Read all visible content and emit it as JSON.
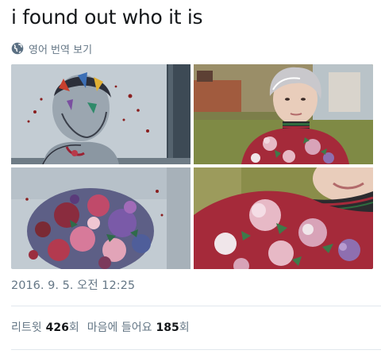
{
  "tweet": {
    "text": "i found out who it is",
    "translate_label": "영어 번역 보기",
    "translate_icon": "globe-icon",
    "timestamp": "2016. 9. 5. 오전 12:25"
  },
  "media": {
    "count": 4,
    "colors": {
      "painting_bg": "#b9c3cb",
      "sweater_red": "#a52a3a",
      "flower_pink": "#e7b9c6",
      "flower_purple": "#8e6fb0",
      "hair_grey": "#c9c8cc",
      "grass_green": "#8a8d4a"
    }
  },
  "stats": {
    "retweets_label": "리트윗",
    "retweets_count": "426",
    "retweets_suffix": "회",
    "likes_label": "마음에 들어요",
    "likes_count": "185",
    "likes_suffix": "회"
  },
  "theme": {
    "text_primary": "#14171a",
    "text_secondary": "#657786",
    "divider": "#e1e8ed"
  }
}
